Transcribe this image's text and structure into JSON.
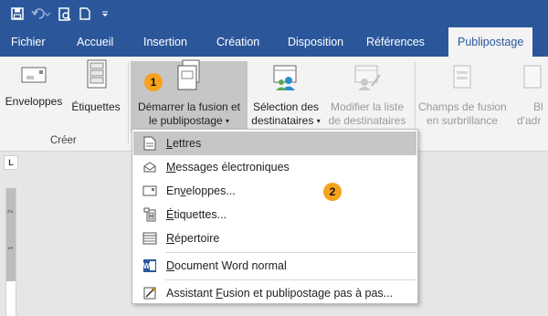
{
  "tabs": [
    {
      "label": "Fichier"
    },
    {
      "label": "Accueil"
    },
    {
      "label": "Insertion"
    },
    {
      "label": "Création"
    },
    {
      "label": "Disposition"
    },
    {
      "label": "Références"
    },
    {
      "label": "Publipostage"
    }
  ],
  "ribbon": {
    "enveloppes": "Enveloppes",
    "etiquettes": "Étiquettes",
    "demarrer_line1": "Démarrer la fusion et",
    "demarrer_line2": "le publipostage",
    "selection_line1": "Sélection des",
    "selection_line2": "destinataires",
    "modifier_line1": "Modifier la liste",
    "modifier_line2": "de destinataires",
    "champs_line1": "Champs de fusion",
    "champs_line2": "en surbrillance",
    "bloc_line1": "Bl",
    "bloc_line2": "d'adr",
    "group_creer": "Créer"
  },
  "menu": {
    "lettres": {
      "first": "L",
      "rest": "ettres"
    },
    "messages": {
      "first": "M",
      "rest": "essages électroniques"
    },
    "enveloppes": {
      "before": "En",
      "u": "v",
      "after": "eloppes..."
    },
    "etiquettes": {
      "first": "É",
      "rest": "tiquettes..."
    },
    "repertoire": {
      "first": "R",
      "rest": "épertoire"
    },
    "document": {
      "first": "D",
      "rest": "ocument Word normal"
    },
    "assistant": {
      "before": "Assistant ",
      "u": "F",
      "after": "usion et publipostage pas à pas..."
    }
  },
  "badges": {
    "one": "1",
    "two": "2"
  },
  "ruler": {
    "corner": "L",
    "m1": "1",
    "m2": "2"
  },
  "colors": {
    "accent": "#2b579a",
    "badge": "#f7a21b"
  }
}
